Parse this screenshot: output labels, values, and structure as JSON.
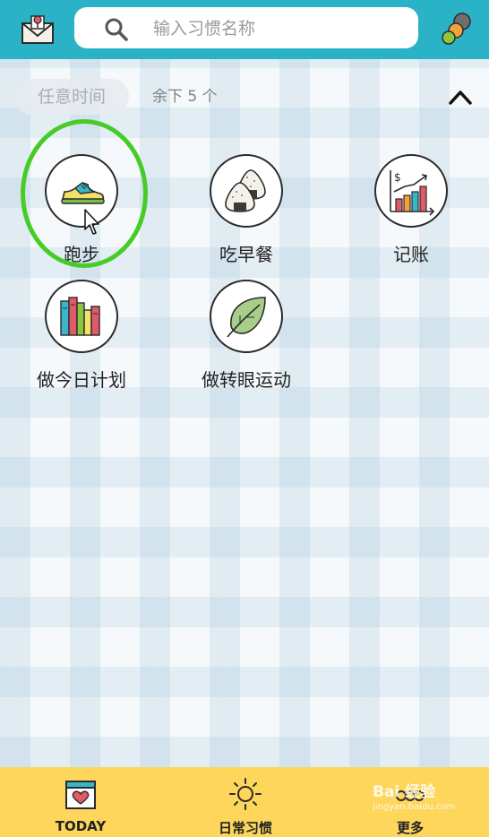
{
  "header": {
    "search_placeholder": "输入习惯名称"
  },
  "section": {
    "time_label": "任意时间",
    "remaining_label": "余下 5 个"
  },
  "habits": [
    {
      "label": "跑步",
      "icon": "running-shoe-icon"
    },
    {
      "label": "吃早餐",
      "icon": "rice-ball-icon"
    },
    {
      "label": "记账",
      "icon": "finance-chart-icon"
    },
    {
      "label": "做今日计划",
      "icon": "books-icon"
    },
    {
      "label": "做转眼运动",
      "icon": "leaf-icon"
    }
  ],
  "bottom_nav": {
    "items": [
      {
        "label": "TODAY",
        "icon": "calendar-heart-icon"
      },
      {
        "label": "日常习惯",
        "icon": "sun-icon"
      },
      {
        "label": "更多",
        "icon": "more-icon"
      }
    ]
  },
  "watermark": {
    "brand": "Bai 经验",
    "url": "jingyan.baidu.com"
  },
  "colors": {
    "header": "#2ab3c7",
    "bottom_nav": "#fdd65b",
    "highlight": "#47cc27"
  }
}
